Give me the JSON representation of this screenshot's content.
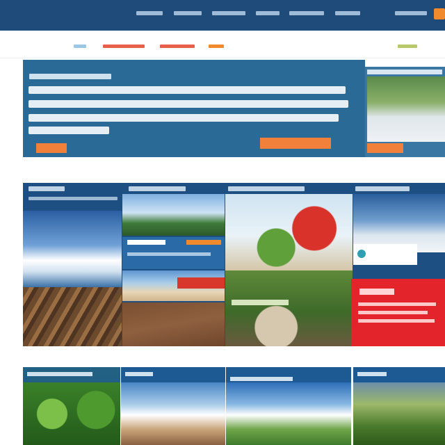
{
  "header": {
    "brand": "",
    "nav": [
      "",
      "",
      "",
      "",
      "",
      ""
    ],
    "action": ""
  },
  "subnav": {
    "logo": "",
    "items": [
      "",
      "",
      ""
    ]
  },
  "hero": {
    "kicker": "",
    "lines": [
      "",
      "",
      "",
      ""
    ],
    "cta_primary": "",
    "cta_secondary": "",
    "side_title": "",
    "side_cta": ""
  },
  "mosaic": {
    "columns": [
      {
        "title": "",
        "subtitle": ""
      },
      {
        "title": "",
        "subtitle": ""
      },
      {
        "title": "",
        "subtitle": ""
      },
      {
        "title": "",
        "subtitle": ""
      }
    ],
    "promo_title": "",
    "promo_lines": [
      "",
      "",
      ""
    ]
  },
  "bottom_cards": [
    {
      "title": ""
    },
    {
      "title": ""
    },
    {
      "title": ""
    },
    {
      "title": ""
    }
  ],
  "colors": {
    "header_bg": "#1e4b7a",
    "accent_orange": "#f0803a",
    "promo_red": "#e3242b"
  }
}
